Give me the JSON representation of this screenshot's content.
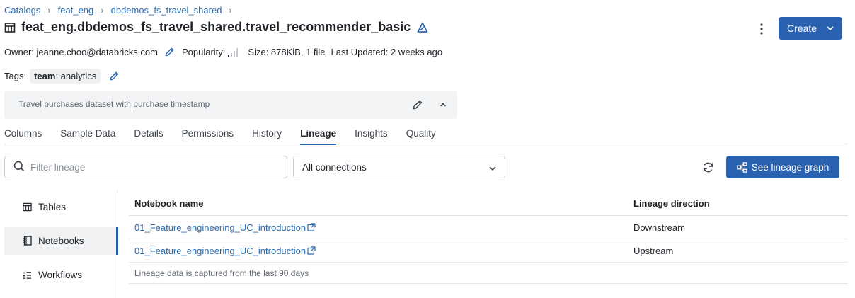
{
  "breadcrumb": {
    "items": [
      "Catalogs",
      "feat_eng",
      "dbdemos_fs_travel_shared"
    ],
    "separator": "›"
  },
  "header": {
    "title": "feat_eng.dbdemos_fs_travel_shared.travel_recommender_basic",
    "create_label": "Create"
  },
  "meta": {
    "owner": "Owner: jeanne.choo@databricks.com",
    "popularity": "Popularity:",
    "size": "Size: 878KiB, 1 file",
    "last_updated": "Last Updated: 2 weeks ago"
  },
  "tags": {
    "label": "Tags:",
    "items": [
      {
        "key": "team",
        "value": ": analytics"
      }
    ]
  },
  "description": "Travel purchases dataset with purchase timestamp",
  "tabs": [
    "Columns",
    "Sample Data",
    "Details",
    "Permissions",
    "History",
    "Lineage",
    "Insights",
    "Quality"
  ],
  "active_tab": "Lineage",
  "filter": {
    "placeholder": "Filter lineage"
  },
  "connections": {
    "selected": "All connections"
  },
  "graph_button": "See lineage graph",
  "sidebar": {
    "items": [
      {
        "label": "Tables",
        "icon": "table-icon"
      },
      {
        "label": "Notebooks",
        "icon": "notebook-icon"
      },
      {
        "label": "Workflows",
        "icon": "workflow-icon"
      }
    ],
    "active": "Notebooks"
  },
  "table": {
    "headers": [
      "Notebook name",
      "Lineage direction"
    ],
    "rows": [
      {
        "name": "01_Feature_engineering_UC_introduction",
        "direction": "Downstream"
      },
      {
        "name": "01_Feature_engineering_UC_introduction",
        "direction": "Upstream"
      }
    ],
    "footer": "Lineage data is captured from the last 90 days"
  },
  "colors": {
    "accent": "#2a62b0",
    "link": "#2a6aae",
    "border": "#c9ccd1"
  }
}
